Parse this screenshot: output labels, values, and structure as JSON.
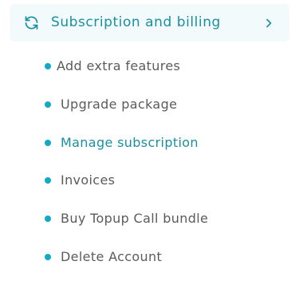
{
  "section": {
    "title": "Subscription and billing",
    "icon": "sync-icon",
    "chevron_icon": "chevron-right-icon",
    "accent_color": "#1a8fa0",
    "background_color": "#f2fafb"
  },
  "menu": {
    "bullet_color": "#11a9c6",
    "items": [
      {
        "label": "Add extra features",
        "active": false
      },
      {
        "label": "Upgrade package",
        "active": false
      },
      {
        "label": "Manage subscription",
        "active": true
      },
      {
        "label": "Invoices",
        "active": false
      },
      {
        "label": "Buy Topup Call bundle",
        "active": false
      },
      {
        "label": "Delete Account",
        "active": false
      }
    ]
  }
}
